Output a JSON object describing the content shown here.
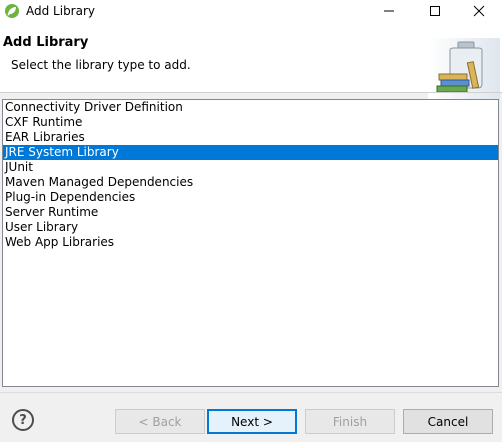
{
  "window": {
    "title": "Add Library",
    "icon": "eclipse-spring-icon"
  },
  "header": {
    "title": "Add Library",
    "description": "Select the library type to add.",
    "graphic": "library-jar-icon"
  },
  "library_types": [
    {
      "label": "Connectivity Driver Definition",
      "selected": false
    },
    {
      "label": "CXF Runtime",
      "selected": false
    },
    {
      "label": "EAR Libraries",
      "selected": false
    },
    {
      "label": "JRE System Library",
      "selected": true
    },
    {
      "label": "JUnit",
      "selected": false
    },
    {
      "label": "Maven Managed Dependencies",
      "selected": false
    },
    {
      "label": "Plug-in Dependencies",
      "selected": false
    },
    {
      "label": "Server Runtime",
      "selected": false
    },
    {
      "label": "User Library",
      "selected": false
    },
    {
      "label": "Web App Libraries",
      "selected": false
    }
  ],
  "footer": {
    "help_label": "?",
    "back_label": "< Back",
    "next_label": "Next >",
    "finish_label": "Finish",
    "cancel_label": "Cancel"
  },
  "colors": {
    "selection": "#0078d7",
    "default_button_border": "#0078d7"
  }
}
